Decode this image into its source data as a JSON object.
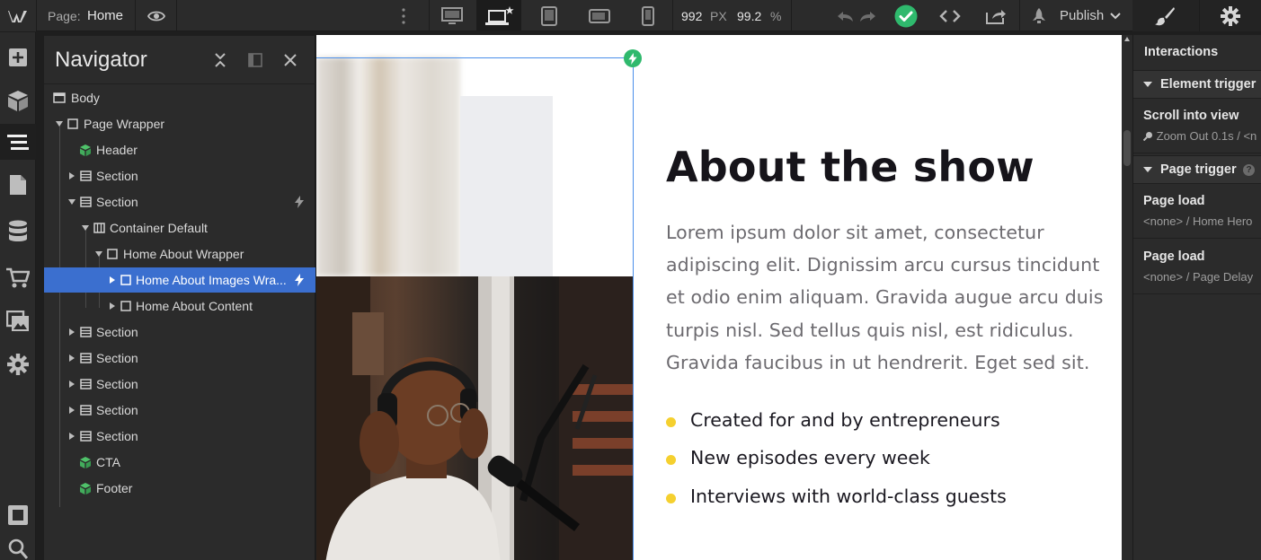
{
  "topbar": {
    "logo": "W",
    "page_label": "Page:",
    "page_name": "Home",
    "canvas_width": "992",
    "width_unit": "PX",
    "zoom": "99.2",
    "zoom_unit": "%",
    "publish_label": "Publish",
    "icons": [
      "webflow-logo-icon",
      "eye-icon",
      "more-vertical-icon",
      "desktop-icon",
      "laptop-star-icon",
      "tablet-icon",
      "tablet-landscape-icon",
      "mobile-icon",
      "undo-icon",
      "redo-icon",
      "check-circle-icon",
      "code-icon",
      "export-icon",
      "rocket-icon",
      "chevron-down-icon",
      "brush-icon",
      "gear-icon"
    ],
    "status_color": "#2fb96d"
  },
  "rail": {
    "icons": [
      "add-icon",
      "cube-icon",
      "navigator-icon",
      "pages-icon",
      "cms-icon",
      "ecommerce-icon",
      "assets-icon",
      "settings-icon",
      "preview-icon",
      "search-icon"
    ]
  },
  "navigator": {
    "title": "Navigator",
    "items": [
      {
        "label": "Body"
      },
      {
        "label": "Page Wrapper"
      },
      {
        "label": "Header"
      },
      {
        "label": "Section"
      },
      {
        "label": "Section"
      },
      {
        "label": "Container Default"
      },
      {
        "label": "Home About Wrapper"
      },
      {
        "label": "Home About Images Wra..."
      },
      {
        "label": "Home About Content"
      },
      {
        "label": "Section"
      },
      {
        "label": "Section"
      },
      {
        "label": "Section"
      },
      {
        "label": "Section"
      },
      {
        "label": "Section"
      },
      {
        "label": "CTA"
      },
      {
        "label": "Footer"
      }
    ],
    "selected_color": "#3b6fcf",
    "symbol_color": "#4fc26a"
  },
  "canvas": {
    "title": "About the show",
    "body": "Lorem ipsum dolor sit amet, consectetur adipiscing elit. Dignissim arcu cursus tincidunt et odio enim aliquam. Gravida augue arcu duis turpis nisl. Sed tellus quis nisl, est ridiculus. Gravida faucibus in ut hendrerit. Eget sed sit.",
    "bullets": [
      "Created for and by entrepreneurs",
      "New episodes every week",
      "Interviews with world-class guests"
    ],
    "bullet_color": "#f5d02f"
  },
  "interactions": {
    "title": "Interactions",
    "element_trigger": "Element trigger",
    "scroll_title": "Scroll into view",
    "scroll_sub": "Zoom Out 0.1s / <n",
    "page_trigger": "Page trigger",
    "help": "?",
    "page_load_1_title": "Page load",
    "page_load_1_sub": "<none> / Home Hero",
    "page_load_2_title": "Page load",
    "page_load_2_sub": "<none> / Page Delay"
  }
}
